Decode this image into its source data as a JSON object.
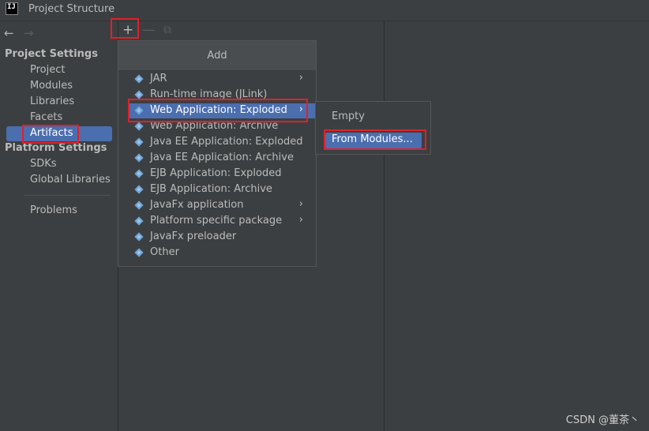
{
  "window": {
    "title": "Project Structure",
    "app_icon": "IJ"
  },
  "nav": {
    "back": "←",
    "forward": "→"
  },
  "sidebar": {
    "project_settings_header": "Project Settings",
    "project_items": [
      "Project",
      "Modules",
      "Libraries",
      "Facets",
      "Artifacts"
    ],
    "platform_settings_header": "Platform Settings",
    "platform_items": [
      "SDKs",
      "Global Libraries"
    ],
    "problems": "Problems"
  },
  "toolbar": {
    "add": "+",
    "remove": "—",
    "copy": "⧉"
  },
  "add_menu": {
    "title": "Add",
    "items": [
      {
        "label": "JAR",
        "submenu": true
      },
      {
        "label": "Run-time image (JLink)",
        "submenu": false
      },
      {
        "label": "Web Application: Exploded",
        "submenu": true
      },
      {
        "label": "Web Application: Archive",
        "submenu": false
      },
      {
        "label": "Java EE Application: Exploded",
        "submenu": false
      },
      {
        "label": "Java EE Application: Archive",
        "submenu": false
      },
      {
        "label": "EJB Application: Exploded",
        "submenu": false
      },
      {
        "label": "EJB Application: Archive",
        "submenu": false
      },
      {
        "label": "JavaFx application",
        "submenu": true
      },
      {
        "label": "Platform specific package",
        "submenu": true
      },
      {
        "label": "JavaFx preloader",
        "submenu": false
      },
      {
        "label": "Other",
        "submenu": false
      }
    ],
    "arrow": "›"
  },
  "sub_menu": {
    "empty": "Empty",
    "from_modules": "From Modules..."
  },
  "watermark": "CSDN @董茶丶",
  "colors": {
    "selection": "#4b6eaf",
    "highlight_box": "#e0202a",
    "background": "#3c3f41"
  }
}
